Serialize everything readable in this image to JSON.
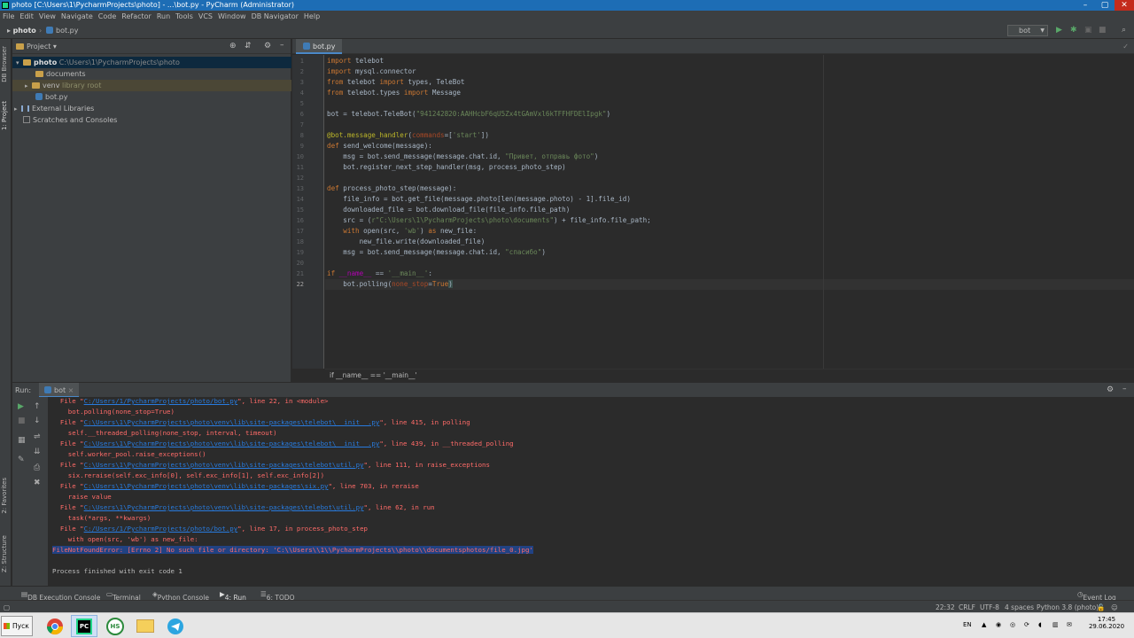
{
  "window": {
    "title": "photo [C:\\Users\\1\\PycharmProjects\\photo] - ...\\bot.py - PyCharm (Administrator)"
  },
  "menu": [
    "File",
    "Edit",
    "View",
    "Navigate",
    "Code",
    "Refactor",
    "Run",
    "Tools",
    "VCS",
    "Window",
    "DB Navigator",
    "Help"
  ],
  "navbar": {
    "project": "photo",
    "file": "bot.py",
    "run_config": "bot"
  },
  "left_stripe": {
    "db_browser": "DB Browser",
    "project": "1: Project",
    "favorites": "2: Favorites",
    "structure": "Z: Structure"
  },
  "project_panel": {
    "title": "Project",
    "root_name": "photo",
    "root_path": "C:\\Users\\1\\PycharmProjects\\photo",
    "documents": "documents",
    "venv": "venv",
    "venv_note": "library root",
    "botpy": "bot.py",
    "ext_libs": "External Libraries",
    "scratches": "Scratches and Consoles"
  },
  "editor": {
    "tab": "bot.py",
    "lines": [
      "1",
      "2",
      "3",
      "4",
      "5",
      "6",
      "7",
      "8",
      "9",
      "10",
      "11",
      "12",
      "13",
      "14",
      "15",
      "16",
      "17",
      "18",
      "19",
      "20",
      "21",
      "22"
    ],
    "code": {
      "l1_kw": "import",
      "l1_rest": " telebot",
      "l2_kw": "import",
      "l2_rest": " mysql.connector",
      "l3_kw1": "from",
      "l3_mid": " telebot ",
      "l3_kw2": "import",
      "l3_rest": " types, TeleBot",
      "l4_kw1": "from",
      "l4_mid": " telebot.types ",
      "l4_kw2": "import",
      "l4_rest": " Message",
      "l6_a": "bot = telebot.TeleBot(",
      "l6_s": "\"941242820:AAHHcbF6qU5Zx4tGAmVxl6kTFFHFDElIpgk\"",
      "l6_b": ")",
      "l8_dec": "@bot.message_handler",
      "l8_a": "(",
      "l8_p": "commands",
      "l8_b": "=[",
      "l8_s": "'start'",
      "l8_c": "])",
      "l9_kw": "def",
      "l9_rest": " send_welcome(message):",
      "l10_a": "    msg = bot.send_message(message.chat.id, ",
      "l10_s": "\"Привет, отправь фото\"",
      "l10_b": ")",
      "l11": "    bot.register_next_step_handler(msg, process_photo_step)",
      "l13_kw": "def",
      "l13_rest": " process_photo_step(message):",
      "l14": "    file_info = bot.get_file(message.photo[len(message.photo) - 1].file_id)",
      "l15": "    downloaded_file = bot.download_file(file_info.file_path)",
      "l16_a": "    src = (",
      "l16_s": "r\"C:\\Users\\1\\PycharmProjects\\photo\\documents\"",
      "l16_b": ") + file_info.file_path;",
      "l17_kw": "    with",
      "l17_a": " open(src, ",
      "l17_s": "'wb'",
      "l17_b": ") ",
      "l17_kw2": "as",
      "l17_c": " new_file:",
      "l18": "        new_file.write(downloaded_file)",
      "l19_a": "    msg = bot.send_message(message.chat.id, ",
      "l19_s": "\"спасибо\"",
      "l19_b": ")",
      "l21_kw": "if",
      "l21_a": " ",
      "l21_dd": "__name__",
      "l21_b": " == ",
      "l21_s": "'__main__'",
      "l21_c": ":",
      "l22_a": "    bot.polling(",
      "l22_p": "none_stop",
      "l22_b": "=",
      "l22_kw": "True",
      "l22_c": ")"
    },
    "breadcrumb": "if __name__ == '__main__'"
  },
  "run_panel": {
    "label": "Run:",
    "tab": "bot",
    "console": {
      "c1_a": "  File \"",
      "c1_l": "C:/Users/1/PycharmProjects/photo/bot.py",
      "c1_b": "\", line 22, in <module>",
      "c2": "    bot.polling(none_stop=True)",
      "c3_a": "  File \"",
      "c3_l": "C:\\Users\\1\\PycharmProjects\\photo\\venv\\lib\\site-packages\\telebot\\__init__.py",
      "c3_b": "\", line 415, in polling",
      "c4": "    self.__threaded_polling(none_stop, interval, timeout)",
      "c5_a": "  File \"",
      "c5_l": "C:\\Users\\1\\PycharmProjects\\photo\\venv\\lib\\site-packages\\telebot\\__init__.py",
      "c5_b": "\", line 439, in __threaded_polling",
      "c6": "    self.worker_pool.raise_exceptions()",
      "c7_a": "  File \"",
      "c7_l": "C:\\Users\\1\\PycharmProjects\\photo\\venv\\lib\\site-packages\\telebot\\util.py",
      "c7_b": "\", line 111, in raise_exceptions",
      "c8": "    six.reraise(self.exc_info[0], self.exc_info[1], self.exc_info[2])",
      "c9_a": "  File \"",
      "c9_l": "C:\\Users\\1\\PycharmProjects\\photo\\venv\\lib\\site-packages\\six.py",
      "c9_b": "\", line 703, in reraise",
      "c10": "    raise value",
      "c11_a": "  File \"",
      "c11_l": "C:\\Users\\1\\PycharmProjects\\photo\\venv\\lib\\site-packages\\telebot\\util.py",
      "c11_b": "\", line 62, in run",
      "c12": "    task(*args, **kwargs)",
      "c13_a": "  File \"",
      "c13_l": "C:/Users/1/PycharmProjects/photo/bot.py",
      "c13_b": "\", line 17, in process_photo_step",
      "c14": "    with open(src, 'wb') as new_file:",
      "c15": "FileNotFoundError: [Errno 2] No such file or directory: 'C:\\\\Users\\\\1\\\\PycharmProjects\\\\photo\\\\documentsphotos/file_0.jpg'",
      "c16": "Process finished with exit code 1"
    }
  },
  "bottom_tools": {
    "db_console": "DB Execution Console",
    "terminal": "Terminal",
    "python_console": "Python Console",
    "run": "4: Run",
    "todo": "6: TODO",
    "event_log": "Event Log"
  },
  "status_bar": {
    "position": "22:32",
    "line_sep": "CRLF",
    "encoding": "UTF-8",
    "indent": "4 spaces",
    "interpreter": "Python 3.8 (photo)"
  },
  "taskbar": {
    "start": "Пуск",
    "lang": "EN",
    "time": "17:45",
    "date": "29.06.2020",
    "hs": "HS",
    "pc": "PC"
  },
  "colors": {
    "accent": "#1d6db5",
    "error": "#ff6b68",
    "link": "#287bde",
    "keyword": "#cc7832",
    "string": "#6a8759"
  }
}
